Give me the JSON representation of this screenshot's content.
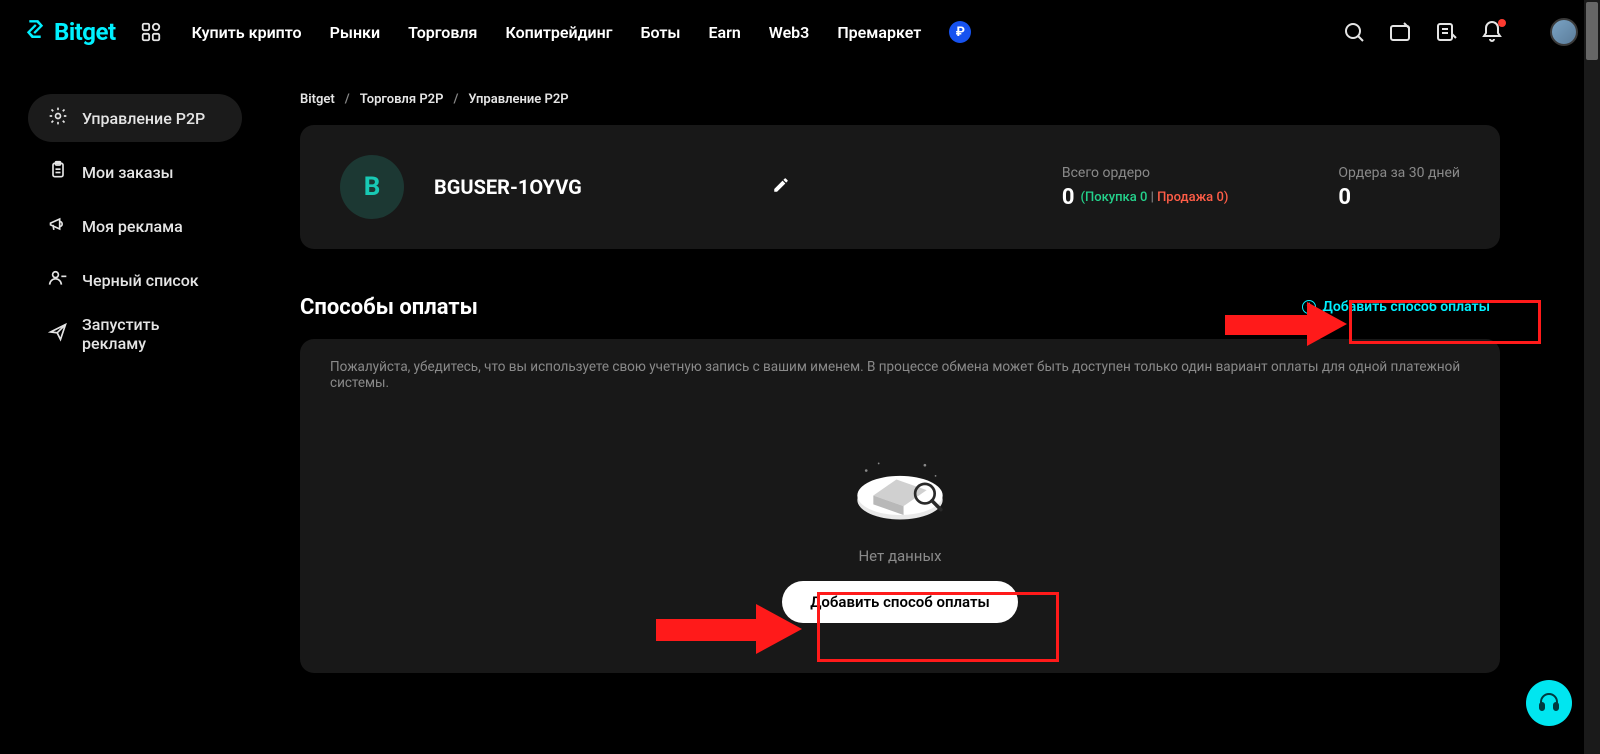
{
  "brand": "Bitget",
  "nav": {
    "items": [
      "Купить крипто",
      "Рынки",
      "Торговля",
      "Копитрейдинг",
      "Боты",
      "Earn",
      "Web3",
      "Премаркет"
    ],
    "currency_symbol": "₽"
  },
  "sidebar": {
    "items": [
      {
        "label": "Управление P2P"
      },
      {
        "label": "Мои заказы"
      },
      {
        "label": "Моя реклама"
      },
      {
        "label": "Черный список"
      },
      {
        "label": "Запустить рекламу"
      }
    ]
  },
  "breadcrumb": {
    "a": "Bitget",
    "b": "Торговля P2P",
    "c": "Управление P2P"
  },
  "profile": {
    "initial": "B",
    "username": "BGUSER-1OYVG",
    "stat1_label": "Всего ордеро",
    "stat1_value": "0",
    "stat1_buy_label": "(Покупка",
    "stat1_buy_value": "0",
    "stat1_sell_label": "Продажа",
    "stat1_sell_value": "0)",
    "stat2_label": "Ордера за 30 дней",
    "stat2_value": "0"
  },
  "payment": {
    "title": "Способы оплаты",
    "add_link": "Добавить способ оплаты",
    "hint": "Пожалуйста, убедитесь, что вы используете свою учетную запись с вашим именем. В процессе обмена может быть доступен только один вариант оплаты для одной платежной системы.",
    "empty_text": "Нет данных",
    "add_button": "Добавить способ оплаты"
  }
}
